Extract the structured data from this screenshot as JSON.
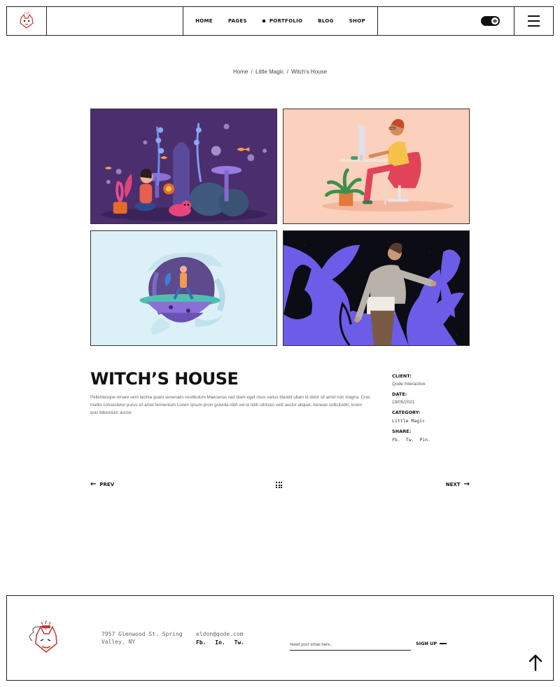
{
  "header": {
    "nav": [
      {
        "label": "HOME",
        "active": false
      },
      {
        "label": "PAGES",
        "active": false
      },
      {
        "label": "PORTFOLIO",
        "active": true
      },
      {
        "label": "BLOG",
        "active": false
      },
      {
        "label": "SHOP",
        "active": false
      }
    ],
    "toggle_icon": "eye-icon",
    "menu_icon": "hamburger-icon"
  },
  "breadcrumb": {
    "items": [
      "Home",
      "Little Magic",
      "Witch's House"
    ],
    "separator": "/"
  },
  "gallery": {
    "images": [
      {
        "name": "underwater-girl-illustration"
      },
      {
        "name": "desk-worker-illustration"
      },
      {
        "name": "floating-island-illustration"
      },
      {
        "name": "hands-reaching-illustration"
      }
    ]
  },
  "project": {
    "title": "WITCH’S HOUSE",
    "description": "Pellentesque ornare sem lacinia quam venenatis vestibulum Maecenas sed diam eget risus varius blandit ullam id dolor sit amet non magna. Cras mattis consectetur purus sit amet fermentum Lorem Ipsum proin gravida nibh vel id nibh ultricies velit auctor aliquet. Aenean sollicitudin, lorem quis bibendum auctor",
    "meta": {
      "client_label": "CLIENT:",
      "client_value": "Qode Interactive",
      "date_label": "DATE:",
      "date_value": "19/05/2021",
      "category_label": "CATEGORY:",
      "category_value": "Little Magic",
      "share_label": "SHARE:",
      "share_links": [
        "Fb.",
        "Tw.",
        "Pin."
      ]
    }
  },
  "pager": {
    "prev_label": "PREV",
    "next_label": "NEXT"
  },
  "footer": {
    "address": "7957 Glenwood St. Spring Valley, NY",
    "email": "eldon@qode.com",
    "social": [
      "Fb.",
      "In.",
      "Tw."
    ],
    "newsletter_placeholder": "Need your email here..",
    "signup_label": "SIGN UP"
  },
  "colors": {
    "border": "#222222",
    "text": "#111111",
    "muted": "#666666",
    "tile1_bg": "#4a2e6e",
    "tile2_bg": "#fbd0bc",
    "tile3_bg": "#dcf0f7",
    "tile4_bg": "#0c0c14"
  }
}
